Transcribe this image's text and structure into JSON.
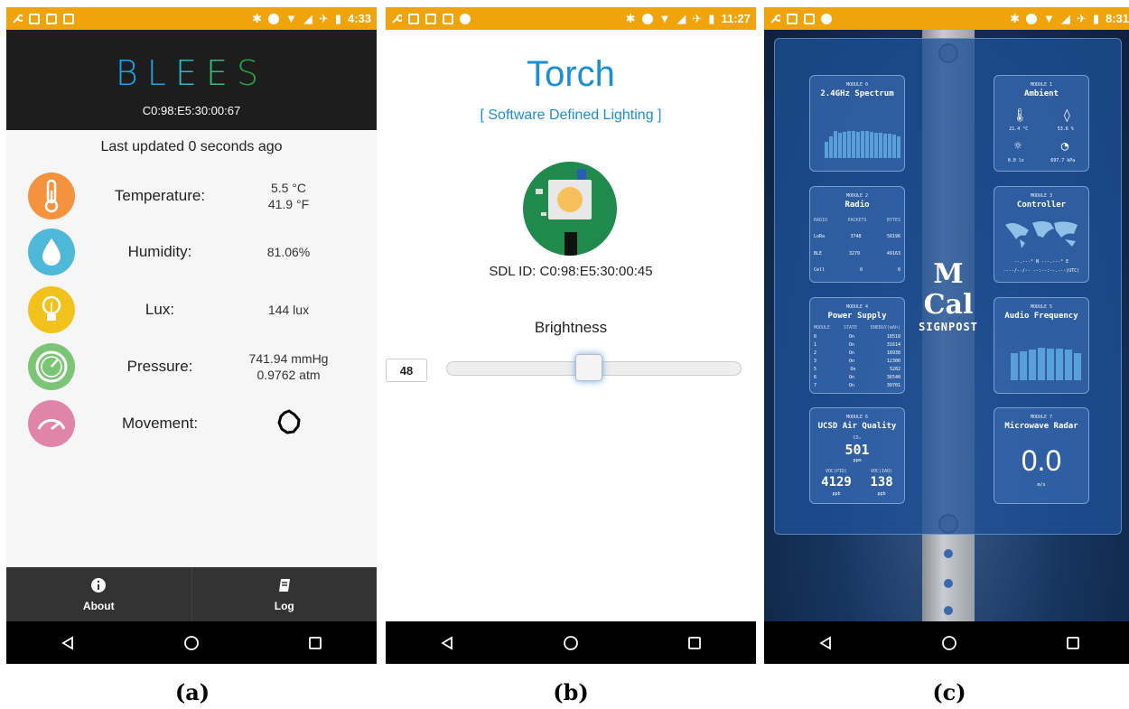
{
  "captions": [
    "(a)",
    "(b)",
    "(c)"
  ],
  "phone_a": {
    "status_time": "4:33",
    "app_title_letters": [
      "B",
      "L",
      "E",
      "E",
      "S"
    ],
    "device_id": "C0:98:E5:30:00:67",
    "last_updated": "Last updated 0 seconds ago",
    "sensors": [
      {
        "label": "Temperature:",
        "value1": "5.5 °C",
        "value2": "41.9 °F",
        "icon": "thermometer-icon",
        "color": "#f5923e"
      },
      {
        "label": "Humidity:",
        "value1": "81.06%",
        "value2": "",
        "icon": "water-drop-icon",
        "color": "#4db8d8"
      },
      {
        "label": "Lux:",
        "value1": "144 lux",
        "value2": "",
        "icon": "light-bulb-icon",
        "color": "#f2c11c"
      },
      {
        "label": "Pressure:",
        "value1": "741.94 mmHg",
        "value2": "0.9762 atm",
        "icon": "gauge-icon",
        "color": "#7cc576"
      },
      {
        "label": "Movement:",
        "value1": "",
        "value2": "",
        "icon": "speedometer-icon",
        "color": "#e085a8"
      }
    ],
    "bottom": {
      "about": "About",
      "log": "Log"
    }
  },
  "phone_b": {
    "status_time": "11:27",
    "title": "Torch",
    "subtitle": "[ Software Defined Lighting ]",
    "sdl_id": "SDL ID: C0:98:E5:30:00:45",
    "brightness_label": "Brightness",
    "brightness_value": "48",
    "brightness_fraction": 0.48
  },
  "phone_c": {
    "status_time": "8:31",
    "logo": "M Cal",
    "signpost": "SIGNPOST",
    "modules": [
      {
        "num": "MODULE 0",
        "name": "2.4GHz Spectrum"
      },
      {
        "num": "MODULE 1",
        "name": "Ambient",
        "temp": "21.4 °C",
        "hum": "53.6 %",
        "lux": "0.0 lx",
        "press": "697.7 kPa"
      },
      {
        "num": "MODULE 2",
        "name": "Radio",
        "headers": [
          "RADIO",
          "PACKETS",
          "BYTES"
        ],
        "rows": [
          [
            "LoRa",
            "3748",
            "56196"
          ],
          [
            "BLE",
            "3279",
            "49163"
          ],
          [
            "Cell",
            "0",
            "0"
          ]
        ]
      },
      {
        "num": "MODULE 3",
        "name": "Controller",
        "coords": "--.---° N ---.---° E",
        "datetime": "----/--/-- --:--:--.---(UTC)"
      },
      {
        "num": "MODULE 4",
        "name": "Power Supply",
        "headers": [
          "MODULE",
          "STATE",
          "ENERGY(mAh)"
        ],
        "rows": [
          [
            "0",
            "On",
            "18518"
          ],
          [
            "1",
            "On",
            "31614"
          ],
          [
            "2",
            "On",
            "18938"
          ],
          [
            "3",
            "On",
            "12300"
          ],
          [
            "5",
            "On",
            "5282"
          ],
          [
            "6",
            "On",
            "36540"
          ],
          [
            "7",
            "On",
            "30701"
          ]
        ]
      },
      {
        "num": "MODULE 5",
        "name": "Audio Frequency"
      },
      {
        "num": "MODULE 6",
        "name": "UCSD Air Quality",
        "co2_label": "CO₂",
        "co2": "501",
        "co2_unit": "ppm",
        "voc_pid_label": "VOC(PID)",
        "voc_pid": "4129",
        "voc_pid_unit": "ppb",
        "voc_iaq_label": "VOC(IAQ)",
        "voc_iaq": "138",
        "voc_iaq_unit": "ppb"
      },
      {
        "num": "MODULE 7",
        "name": "Microwave Radar",
        "value": "0.0",
        "unit": "m/s"
      }
    ]
  }
}
